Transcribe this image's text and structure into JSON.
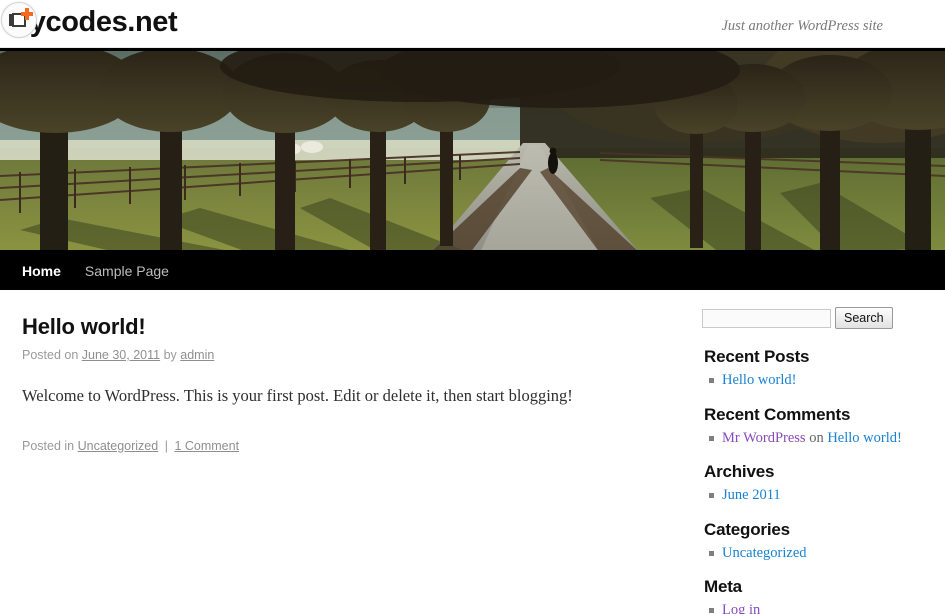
{
  "site": {
    "title": "Mycodes.net",
    "description": "Just another WordPress site",
    "logo_icon": "add-to-collection-badge-icon"
  },
  "nav": {
    "items": [
      {
        "label": "Home",
        "active": true
      },
      {
        "label": "Sample Page",
        "active": false
      }
    ]
  },
  "post": {
    "title": "Hello world!",
    "meta_posted_on": "Posted on",
    "meta_date": "June 30, 2011",
    "meta_by": "by",
    "meta_author": "admin",
    "body": "Welcome to WordPress. This is your first post. Edit or delete it, then start blogging!",
    "footer_posted_in": "Posted in",
    "footer_category": "Uncategorized",
    "footer_separator": "|",
    "footer_comments": "1 Comment"
  },
  "sidebar": {
    "search": {
      "value": "",
      "placeholder": "",
      "button_label": "Search"
    },
    "widgets": [
      {
        "title": "Recent Posts",
        "items": [
          {
            "text": "Hello world!",
            "style": "link-blue"
          }
        ]
      },
      {
        "title": "Recent Comments",
        "items": [
          {
            "author": "Mr WordPress",
            "connector": "on",
            "post": "Hello world!"
          }
        ]
      },
      {
        "title": "Archives",
        "items": [
          {
            "text": "June 2011",
            "style": "link-blue"
          }
        ]
      },
      {
        "title": "Categories",
        "items": [
          {
            "text": "Uncategorized",
            "style": "link-blue"
          }
        ]
      },
      {
        "title": "Meta",
        "items": [
          {
            "text": "Log in",
            "style": "link-visited"
          }
        ]
      }
    ]
  },
  "colors": {
    "link": "#1982d1",
    "visited_link": "#8a4bbd",
    "nav_background": "#000000",
    "accent_orange": "#f26b21",
    "text": "#2f2f2f",
    "muted": "#9a9a9a"
  }
}
